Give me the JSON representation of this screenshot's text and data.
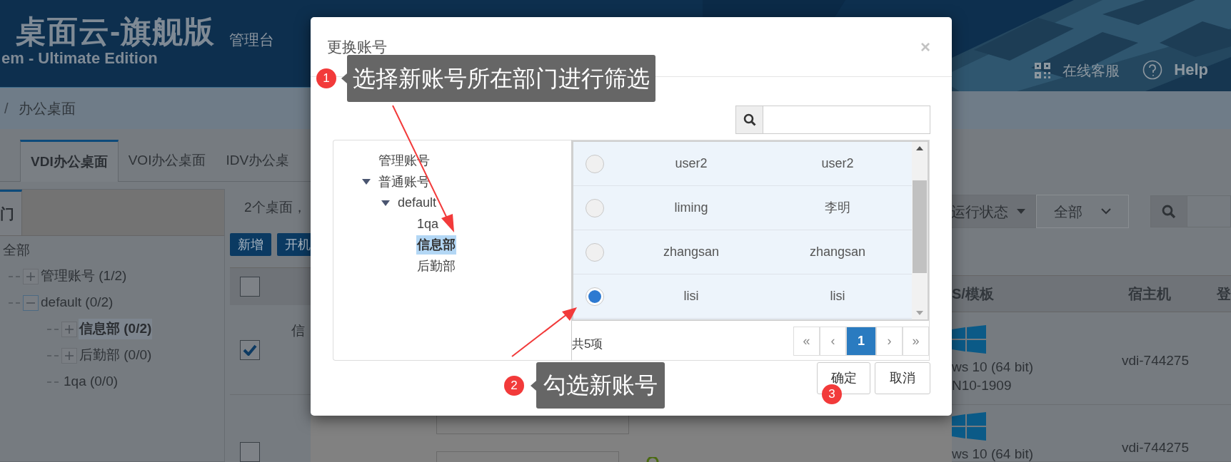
{
  "header": {
    "title": "桌面云-旗舰版",
    "subtitle": "em - Ultimate Edition",
    "console_label": "管理台",
    "links": [
      {
        "kind": "qr",
        "label": "在线客服"
      },
      {
        "kind": "help",
        "label": "Help"
      }
    ]
  },
  "breadcrumb": {
    "separator": "/",
    "current": "办公桌面"
  },
  "tabs": [
    {
      "label": "VDI办公桌面",
      "selected": true
    },
    {
      "label": "VOI办公桌面",
      "selected": false
    },
    {
      "label": "IDV办公桌",
      "selected": false
    }
  ],
  "dept_panel": {
    "tab": "门",
    "root": "全部",
    "tree": [
      {
        "label": "管理账号 (1/2)",
        "expanded": false,
        "selected": false
      },
      {
        "label": "default (0/2)",
        "expanded": true,
        "selected": false,
        "children": [
          {
            "label": "信息部 (0/2)",
            "expanded": false,
            "selected": true
          },
          {
            "label": "后勤部 (0/0)",
            "expanded": false,
            "selected": false
          },
          {
            "label": "1qa (0/0)",
            "kind": "leaf",
            "selected": false
          }
        ]
      }
    ]
  },
  "content": {
    "summary": "2个桌面，",
    "toolbar": [
      "新增",
      "开机"
    ]
  },
  "filters": {
    "status_label": "运行状态",
    "status_value": "全部"
  },
  "table": {
    "header_checked": false,
    "columns": [
      "S/模板",
      "宿主机",
      "登"
    ],
    "rows": [
      {
        "checked": true,
        "cell": "信",
        "os": "ws 10 (64 bit)",
        "template": "N10-1909",
        "host": "vdi-744275"
      },
      {
        "checked": false,
        "os": "ws 10 (64 bit)",
        "host": "vdi-744275"
      }
    ]
  },
  "modal": {
    "title": "更换账号",
    "close": "×",
    "tree": [
      {
        "label": "管理账号",
        "kind": "leaf",
        "selected": false
      },
      {
        "label": "普通账号",
        "expanded": true,
        "selected": false,
        "children": [
          {
            "label": "default",
            "expanded": true,
            "selected": false,
            "children": [
              {
                "label": "1qa",
                "kind": "leaf",
                "selected": false
              },
              {
                "label": "信息部",
                "kind": "leaf",
                "selected": true
              },
              {
                "label": "后勤部",
                "kind": "leaf",
                "selected": false
              }
            ]
          }
        ]
      }
    ],
    "accounts": [
      {
        "username": "user2",
        "name": "user2",
        "selected": false
      },
      {
        "username": "liming",
        "name": "李明",
        "selected": false
      },
      {
        "username": "zhangsan",
        "name": "zhangsan",
        "selected": false
      },
      {
        "username": "lisi",
        "name": "lisi",
        "selected": true
      }
    ],
    "total": "共5项",
    "pagination": [
      {
        "label": "«",
        "selected": false
      },
      {
        "label": "‹",
        "selected": false
      },
      {
        "label": "1",
        "selected": true
      },
      {
        "label": "›",
        "selected": false
      },
      {
        "label": "»",
        "selected": false
      }
    ],
    "buttons": [
      "确定",
      "取消"
    ]
  },
  "annotations": [
    {
      "number": "1",
      "text": "选择新账号所在部门进行筛选"
    },
    {
      "number": "2",
      "text": "勾选新账号"
    },
    {
      "number": "3"
    }
  ]
}
